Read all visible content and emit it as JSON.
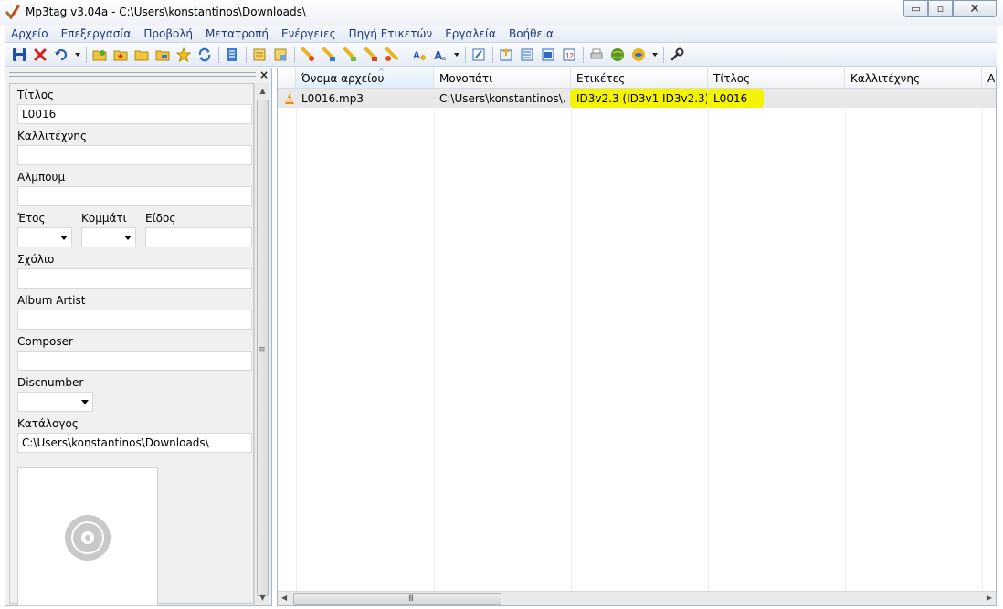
{
  "window": {
    "title": "Mp3tag v3.04a  -  C:\\Users\\konstantinos\\Downloads\\",
    "minimize_glyph": "▭",
    "maximize_glyph": "▫",
    "close_glyph": "✕"
  },
  "menu": [
    "Αρχείο",
    "Επεξεργασία",
    "Προβολή",
    "Μετατροπή",
    "Ενέργειες",
    "Πηγή Ετικετών",
    "Εργαλεία",
    "Βοήθεια"
  ],
  "toolbar": {
    "icons": [
      "save-icon",
      "delete-icon",
      "undo-icon",
      "undo-dropdown-icon",
      "open-folder-icon",
      "add-folder-icon",
      "folder-icon",
      "folder-favorites-icon",
      "star-icon",
      "refresh-icon",
      "list-icon",
      "tag-to-filename-icon",
      "filename-to-tag-icon",
      "export-icon",
      "import-icon",
      "actions-icon",
      "actions-quick-icon",
      "action-group-icon",
      "case-conversion-icon",
      "case-dropdown-icon",
      "edit-icon",
      "export-playlist-icon",
      "playlist-icon",
      "playlist-2-icon",
      "numbering-icon",
      "print-icon",
      "web-source-icon",
      "web-source-dropdown-icon",
      "settings-wrench-icon"
    ]
  },
  "left_panel": {
    "close_label": "×",
    "fields": {
      "title_label": "Τίτλος",
      "title_value": "L0016",
      "artist_label": "Καλλιτέχνης",
      "artist_value": "",
      "album_label": "Αλμπουμ",
      "album_value": "",
      "year_label": "Έτος",
      "track_label": "Κομμάτι",
      "genre_label": "Είδος",
      "comment_label": "Σχόλιο",
      "comment_value": "",
      "album_artist_label": "Album Artist",
      "album_artist_value": "",
      "composer_label": "Composer",
      "composer_value": "",
      "discnumber_label": "Discnumber",
      "directory_label": "Κατάλογος",
      "directory_value": "C:\\Users\\konstantinos\\Downloads\\"
    },
    "scroll_grip": "≡"
  },
  "file_list": {
    "columns": [
      "Όνομα αρχείου",
      "Μονοπάτι",
      "Ετικέτες",
      "Τίτλος",
      "Καλλιτέχνης",
      "A"
    ],
    "sort_caret": "^",
    "rows": [
      {
        "filename": "L0016.mp3",
        "path": "C:\\Users\\konstantinos\\...",
        "tags": "ID3v2.3 (ID3v1 ID3v2.3)",
        "title": "L0016",
        "artist": ""
      }
    ],
    "highlight_color": "#f4f400",
    "hscroll_grip": "III"
  }
}
